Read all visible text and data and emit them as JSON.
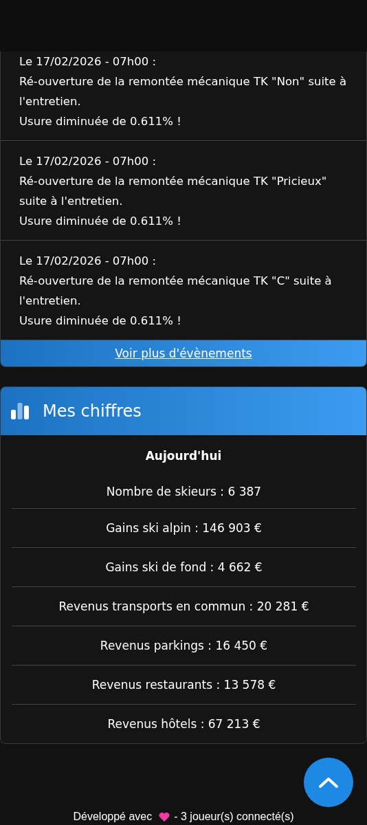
{
  "events": [
    {
      "date": "Le 17/02/2026 - 07h00 :",
      "text": "Ré-ouverture de la remontée mécanique TK \"Non\" suite à l'entretien.",
      "wear": "Usure diminuée de 0.611% !"
    },
    {
      "date": "Le 17/02/2026 - 07h00 :",
      "text": "Ré-ouverture de la remontée mécanique TK \"Pricieux\" suite à l'entretien.",
      "wear": "Usure diminuée de 0.611% !"
    },
    {
      "date": "Le 17/02/2026 - 07h00 :",
      "text": "Ré-ouverture de la remontée mécanique TK \"C\" suite à l'entretien.",
      "wear": "Usure diminuée de 0.611% !"
    }
  ],
  "more_link": "Voir plus d'évènements",
  "stats": {
    "title": "Mes chiffres",
    "period": "Aujourd'hui",
    "rows": [
      "Nombre de skieurs : 6 387",
      "Gains ski alpin : 146 903 €",
      "Gains ski de fond : 4 662 €",
      "Revenus transports en commun : 20 281 €",
      "Revenus parkings : 16 450 €",
      "Revenus restaurants : 13 578 €",
      "Revenus hôtels : 67 213 €"
    ]
  },
  "footer": {
    "before": "Développé avec",
    "after": "- 3 joueur(s) connecté(s)"
  }
}
